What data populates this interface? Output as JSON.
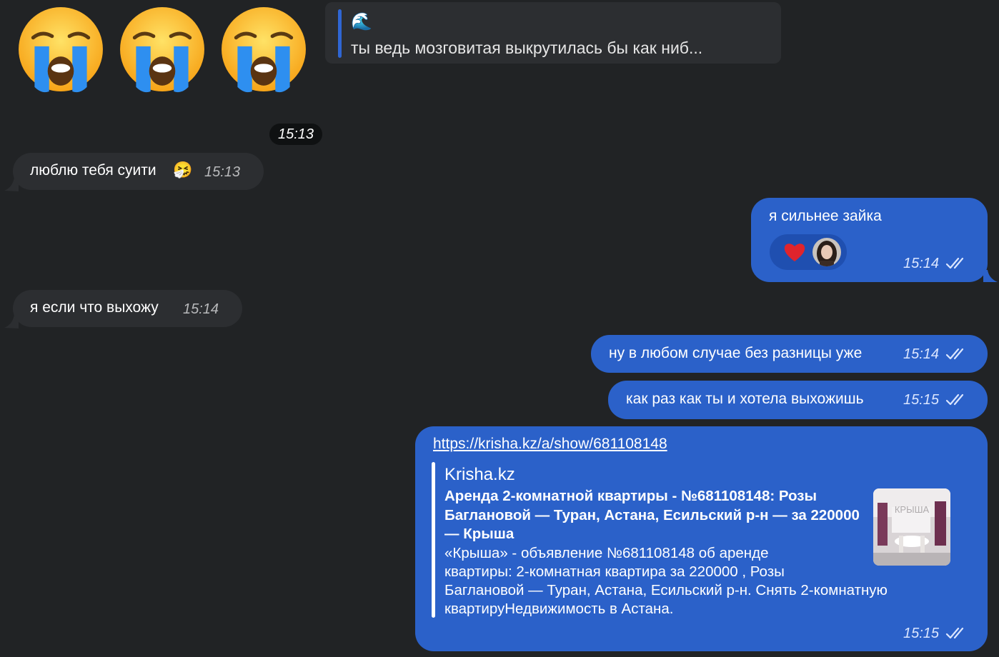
{
  "chat": {
    "big_emojis": [
      "😭",
      "😭",
      "😭"
    ],
    "reply_quote": {
      "icon": "🌊",
      "text": "ты ведь мозговитая выкрутилась бы как ниб..."
    },
    "time_pill": "15:13",
    "messages": [
      {
        "direction": "incoming",
        "text": "люблю тебя суити",
        "emoji": "🤧",
        "time": "15:13"
      },
      {
        "direction": "outgoing",
        "text": "я сильнее зайка",
        "time": "15:14",
        "reaction": "heart-icon"
      },
      {
        "direction": "incoming",
        "text": "я если что выхожу",
        "time": "15:14"
      },
      {
        "direction": "outgoing",
        "text": "ну в любом случае без разницы уже",
        "time": "15:14"
      },
      {
        "direction": "outgoing",
        "text": "как раз как ты и хотела выхожишь",
        "time": "15:15"
      },
      {
        "direction": "outgoing",
        "link": "https://krisha.kz/a/show/681108148",
        "preview": {
          "site": "Krisha.kz",
          "title": "Аренда 2-комнатной квартиры - №681108148: Розы Баглановой — Туран, Астана, Есильский р-н — за 220000 — Крыша",
          "description_lines": [
            "«Крыша» - объявление №681108148 об аренде",
            "квартиры: 2-комнатная квартира за 220000 , Розы",
            "Баглановой — Туран, Астана, Есильский р-н. Снять 2-комнатную",
            "квартируНедвижимость в Астана."
          ],
          "thumbnail_watermark": "КРЫША"
        },
        "time": "15:15"
      }
    ]
  },
  "colors": {
    "background": "#212325",
    "incoming_bubble": "#2c2e31",
    "outgoing_bubble": "#2b61c9",
    "reaction_bg": "#1f4fb0",
    "accent_bar": "#2f66d4",
    "time_pill_bg": "#0f1112"
  }
}
